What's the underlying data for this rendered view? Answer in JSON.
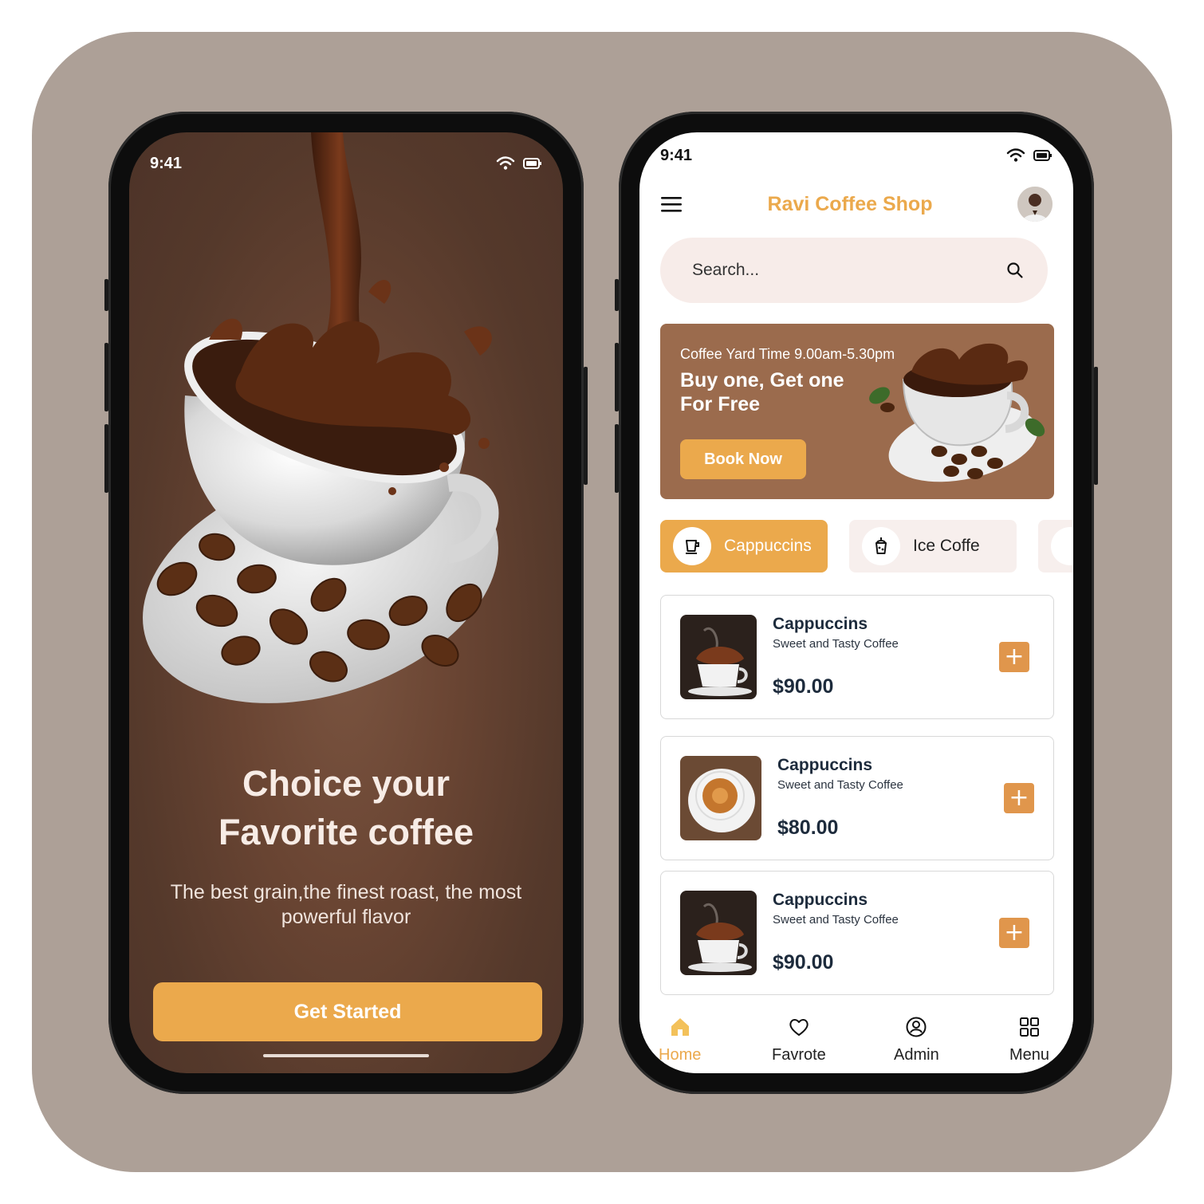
{
  "onboarding": {
    "status_time": "9:41",
    "title_line1": "Choice your",
    "title_line2": "Favorite coffee",
    "subtitle": "The best grain,the finest roast, the most powerful flavor",
    "cta_label": "Get Started"
  },
  "home": {
    "status_time": "9:41",
    "app_title": "Ravi Coffee Shop",
    "search": {
      "placeholder": "Search..."
    },
    "promo": {
      "time": "Coffee Yard Time 9.00am-5.30pm",
      "headline_line1": "Buy one, Get one",
      "headline_line2": "For Free",
      "button": "Book Now"
    },
    "categories": [
      {
        "label": "Cappuccins",
        "active": true
      },
      {
        "label": "Ice Coffe",
        "active": false
      }
    ],
    "products": [
      {
        "name": "Cappuccins",
        "desc": "Sweet and Tasty Coffee",
        "price": "$90.00"
      },
      {
        "name": "Cappuccins",
        "desc": "Sweet and Tasty Coffee",
        "price": "$80.00"
      },
      {
        "name": "Cappuccins",
        "desc": "Sweet and Tasty Coffee",
        "price": "$90.00"
      }
    ],
    "nav": [
      {
        "label": "Home",
        "icon": "home-icon",
        "active": true
      },
      {
        "label": "Favrote",
        "icon": "heart-icon",
        "active": false
      },
      {
        "label": "Admin",
        "icon": "user-circle-icon",
        "active": false
      },
      {
        "label": "Menu",
        "icon": "grid-icon",
        "active": false
      }
    ]
  },
  "colors": {
    "accent": "#eba94c",
    "stage": "#ada097",
    "promo_bg": "#9b6b4d",
    "onboarding_bg": "#6a4533"
  }
}
